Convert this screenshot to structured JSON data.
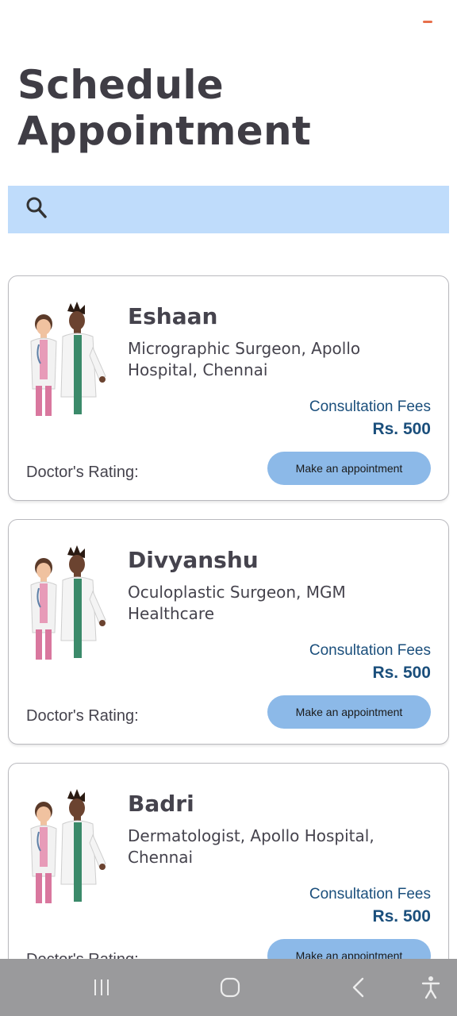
{
  "header": {
    "title": "Schedule Appointment"
  },
  "search": {
    "placeholder": "",
    "value": ""
  },
  "doctors": [
    {
      "name": "Eshaan",
      "specialty": "Micrographic Surgeon, Apollo Hospital, Chennai",
      "fees_label": "Consultation Fees",
      "fees_value": "Rs. 500",
      "rating_label": "Doctor's Rating:",
      "button_label": "Make an appointment"
    },
    {
      "name": "Divyanshu",
      "specialty": "Oculoplastic Surgeon, MGM Healthcare",
      "fees_label": "Consultation Fees",
      "fees_value": "Rs. 500",
      "rating_label": "Doctor's Rating:",
      "button_label": "Make an appointment"
    },
    {
      "name": "Badri",
      "specialty": "Dermatologist, Apollo Hospital, Chennai",
      "fees_label": "Consultation Fees",
      "fees_value": "Rs. 500",
      "rating_label": "Doctor's Rating:",
      "button_label": "Make an appointment"
    }
  ],
  "icons": {
    "search": "search-icon",
    "doctors_illustration": "doctors-illustration",
    "nav_recents": "recents-icon",
    "nav_home": "home-icon",
    "nav_back": "back-icon",
    "nav_accessibility": "accessibility-icon"
  },
  "colors": {
    "search_bg": "#bfdcfb",
    "button_bg": "#8cb9e8",
    "fees_text": "#1b4f7c",
    "title_text": "#3f3d45",
    "nav_bar_bg": "#9a9a9c"
  }
}
